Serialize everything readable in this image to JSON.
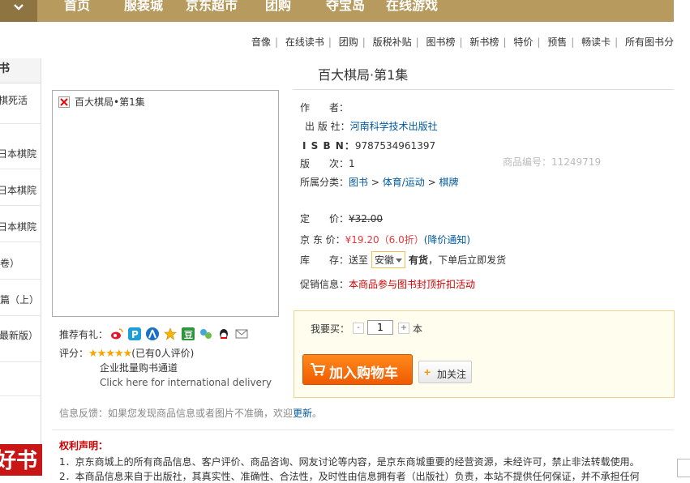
{
  "top_nav": {
    "items": [
      "首页",
      "服装城",
      "京东超市",
      "团购",
      "夺宝岛",
      "在线游戏"
    ]
  },
  "sub_links": [
    "音像",
    "在线读书",
    "团购",
    "版税补贴",
    "图书榜",
    "新书榜",
    "特价",
    "预售",
    "畅读卡",
    "所有图书分"
  ],
  "left_sidebar": {
    "header": "书",
    "items": [
      "棋死活",
      "日本棋院",
      "日本棋院",
      "日本棋院",
      "卷）",
      "篇（上）",
      "最新版）"
    ],
    "logo_text": "好书"
  },
  "product": {
    "title": "百大棋局·第1集",
    "image_alt": "百大棋局•第1集",
    "author_label": "作　　者：",
    "author_value": "",
    "publisher_label": "出 版 社：",
    "publisher_value": "河南科学技术出版社",
    "isbn_label": "I S B N：",
    "isbn_value": "9787534961397",
    "edition_label": "版　　次：",
    "edition_value": "1",
    "sku_text": "商品编号：11249719",
    "category_label": "所属分类：",
    "category_path": [
      "图书",
      "体育/运动",
      "棋牌"
    ],
    "category_sep": " > ",
    "list_price_label": "定　　价：",
    "list_price": "¥32.00",
    "jd_price_label": "京 东 价：",
    "jd_price": "¥19.20（6.0折）",
    "price_notice": "(降价通知)",
    "stock_label": "库　　存：",
    "ship_to": "送至",
    "province": "安徽",
    "stock_status": "有货",
    "stock_note": "，下单后立即发货",
    "promo_label": "促销信息：",
    "promo_text": "本商品参与图书封顶折扣活动"
  },
  "buy": {
    "qty_label": "我要买：",
    "minus": "-",
    "qty": "1",
    "plus": "+",
    "unit": "本",
    "add_to_cart": "加入购物车",
    "follow": "加关注",
    "follow_plus": "+"
  },
  "share": {
    "label": "推荐有礼：",
    "icons": [
      "weibo-icon",
      "pengyou-icon",
      "renren-icon",
      "star-icon",
      "douban-icon",
      "kaixin-icon",
      "qq-icon",
      "mail-icon"
    ]
  },
  "rating": {
    "label": "评分：",
    "stars": "★★★★★",
    "count_text": "(已有0人评价)"
  },
  "bulk_text": "企业批量购书通道",
  "intl_text": "Click here for international delivery",
  "feedback": {
    "text": "信息反馈：如果您发现商品信息或者图片不准确，欢迎",
    "link": "更新",
    "end": "。"
  },
  "rights": {
    "title": "权利声明：",
    "line1": "1．京东商城上的所有商品信息、客户评价、商品咨询、网友讨论等内容，是京东商城重要的经营资源，未经许可，禁止非法转载使用。",
    "line2": "2．本商品信息来自于出版社，其真实性、准确性、合法性，及时性由信息拥有者（出版社）负责，本站不提供任何保证，并不承担任何"
  },
  "colors": {
    "nav_bg": "#b69a5e",
    "price_red": "#e4393c",
    "link_blue": "#005aa0",
    "cart_orange": "#ef5a00"
  }
}
